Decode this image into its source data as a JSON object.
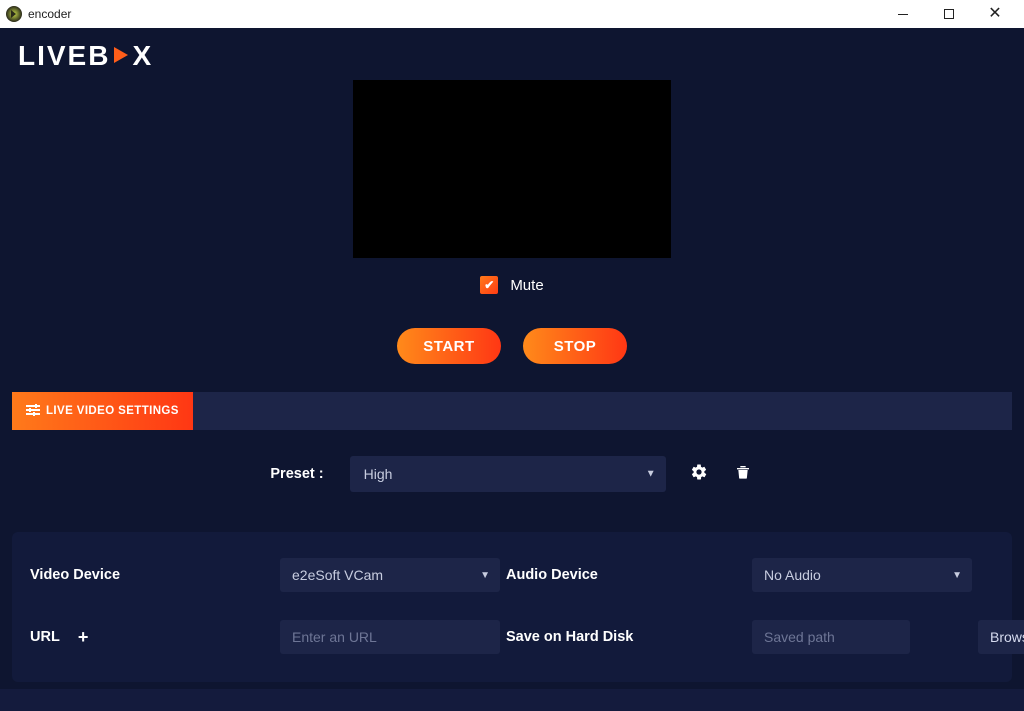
{
  "window": {
    "title": "encoder"
  },
  "logo": {
    "prefix": "LIVEB",
    "suffix": "X"
  },
  "preview": {
    "mute_label": "Mute",
    "mute_checked": true
  },
  "controls": {
    "start_label": "START",
    "stop_label": "STOP"
  },
  "tabs": {
    "live_video_settings": "LIVE VIDEO SETTINGS"
  },
  "preset": {
    "label": "Preset :",
    "value": "High"
  },
  "device": {
    "video_label": "Video Device",
    "video_value": "e2eSoft VCam",
    "audio_label": "Audio Device",
    "audio_value": "No Audio",
    "url_label": "URL",
    "url_placeholder": "Enter an URL",
    "save_label": "Save on Hard Disk",
    "save_placeholder": "Saved path",
    "browse_label": "Browse"
  }
}
